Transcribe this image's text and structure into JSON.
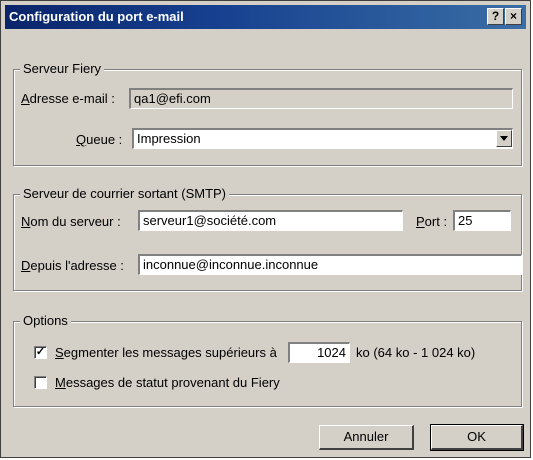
{
  "window": {
    "title": "Configuration du port e-mail",
    "help_label": "?",
    "close_label": "×"
  },
  "fiery_group": {
    "legend": "Serveur Fiery",
    "email_label_u": "A",
    "email_label_rest": "dresse e-mail :",
    "email_value": "qa1@efi.com",
    "queue_label_u": "Q",
    "queue_label_rest": "ueue :",
    "queue_value": "Impression"
  },
  "smtp_group": {
    "legend": "Serveur de courrier sortant (SMTP)",
    "server_label_u": "N",
    "server_label_rest": "om du serveur :",
    "server_value": "serveur1@société.com",
    "port_label_u": "P",
    "port_label_rest": "ort :",
    "port_value": "25",
    "from_label_u": "D",
    "from_label_rest": "epuis l'adresse :",
    "from_value": "inconnue@inconnue.inconnue"
  },
  "options_group": {
    "legend": "Options",
    "segment_checked": true,
    "segment_label_u": "S",
    "segment_label_rest": "egmenter les messages supérieurs à",
    "segment_value": "1024",
    "segment_suffix": "ko (64 ko - 1 024 ko)",
    "status_checked": false,
    "status_label_u": "M",
    "status_label_rest": "essages de statut provenant du Fiery"
  },
  "buttons": {
    "cancel": "Annuler",
    "ok": "OK"
  },
  "colors": {
    "titlebar": "#0a246a",
    "face": "#d4d0c8"
  }
}
